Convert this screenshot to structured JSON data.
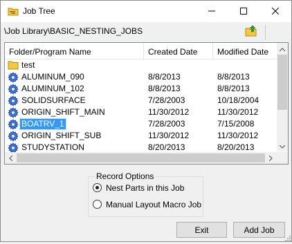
{
  "window": {
    "title": "Job Tree",
    "controls": {
      "minimize": "minimize-icon",
      "maximize": "maximize-icon",
      "close": "close-icon"
    }
  },
  "path": {
    "text": "\\Job Library\\BASIC_NESTING_JOBS",
    "up_icon": "folder-up-icon"
  },
  "list": {
    "columns": [
      "Folder/Program Name",
      "Created Date",
      "Modified Date"
    ],
    "rows": [
      {
        "icon": "folder-icon",
        "name": "test",
        "created": "",
        "modified": "",
        "selected": false
      },
      {
        "icon": "gear-icon",
        "name": "ALUMINUM_090",
        "created": "8/8/2013",
        "modified": "8/8/2013",
        "selected": false
      },
      {
        "icon": "gear-icon",
        "name": "ALUMINUM_102",
        "created": "8/8/2013",
        "modified": "8/8/2013",
        "selected": false
      },
      {
        "icon": "gear-icon",
        "name": "SOLIDSURFACE",
        "created": "7/28/2003",
        "modified": "10/18/2004",
        "selected": false
      },
      {
        "icon": "gear-icon",
        "name": "ORIGIN_SHIFT_MAIN",
        "created": "11/30/2012",
        "modified": "11/30/2012",
        "selected": false
      },
      {
        "icon": "gear-icon",
        "name": "BOATRV_1",
        "created": "7/28/2003",
        "modified": "7/15/2008",
        "selected": true
      },
      {
        "icon": "gear-icon",
        "name": "ORIGIN_SHIFT_SUB",
        "created": "11/30/2012",
        "modified": "11/30/2012",
        "selected": false
      },
      {
        "icon": "gear-icon",
        "name": "STUDYSTATION",
        "created": "8/20/2013",
        "modified": "8/20/2013",
        "selected": false
      }
    ]
  },
  "record_options": {
    "title": "Record Options",
    "options": [
      {
        "label": "Nest Parts in this Job",
        "checked": true
      },
      {
        "label": "Manual Layout Macro Job",
        "checked": false
      }
    ]
  },
  "buttons": {
    "exit": "Exit",
    "add_job": "Add Job"
  },
  "colors": {
    "selection": "#3399ff",
    "folder": "#f5c842",
    "gear": "#3a6fd8"
  }
}
